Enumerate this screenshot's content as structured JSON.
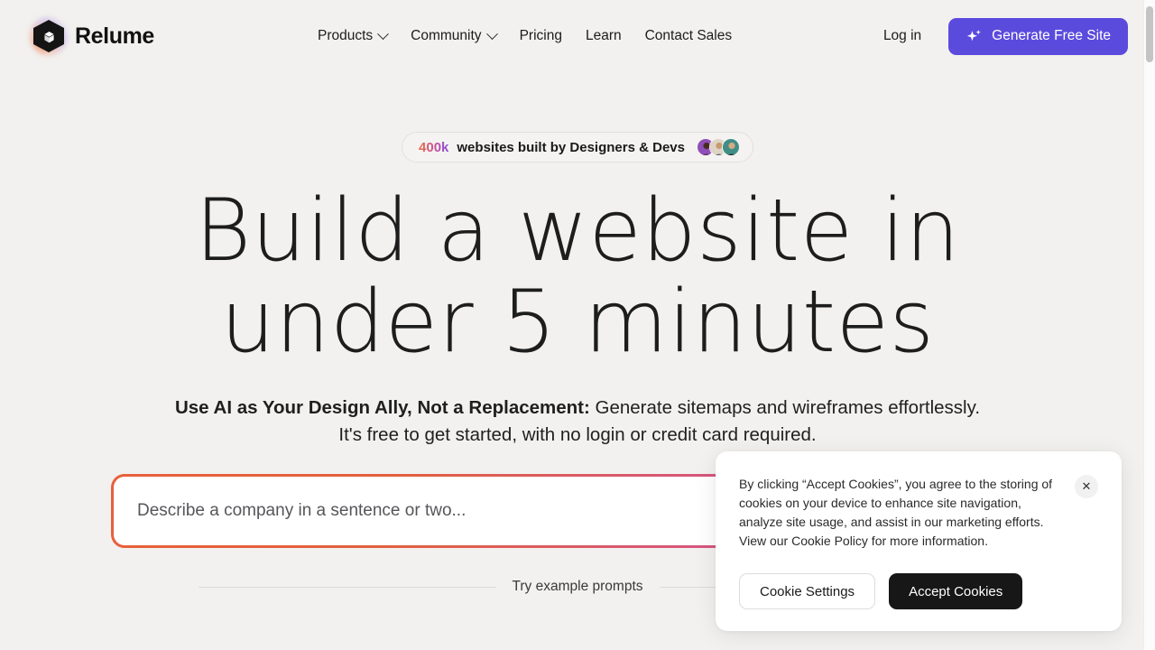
{
  "brand": {
    "name": "Relume",
    "logo_icon": "cube-hexagon-logo"
  },
  "nav": {
    "items": [
      {
        "label": "Products",
        "has_dropdown": true,
        "icon": "chevron-down-icon"
      },
      {
        "label": "Community",
        "has_dropdown": true,
        "icon": "chevron-down-icon"
      },
      {
        "label": "Pricing",
        "has_dropdown": false
      },
      {
        "label": "Learn",
        "has_dropdown": false
      },
      {
        "label": "Contact Sales",
        "has_dropdown": false
      }
    ],
    "login_label": "Log in",
    "cta_label": "Generate Free Site",
    "cta_icon": "sparkle-icon",
    "cta_color": "#5b4bdd"
  },
  "hero": {
    "badge": {
      "count": "400k",
      "text": "websites built by Designers & Devs",
      "count_gradient_from": "#ef6b43",
      "count_gradient_to": "#8d4ce0",
      "avatars": [
        "avatar-designer-1",
        "avatar-designer-2",
        "avatar-designer-3"
      ]
    },
    "headline_line1": "Build a website in",
    "headline_line2": "under 5 minutes",
    "subhead_bold": "Use AI as Your Design Ally, Not a Replacement:",
    "subhead_rest": " Generate sitemaps and wireframes effortlessly. It's free to get started, with no login or credit card required.",
    "prompt_placeholder": "Describe a company in a sentence or two...",
    "prompt_value": "",
    "prompt_border_from": "#e8603c",
    "prompt_border_to": "#a8479e",
    "examples_label": "Try example prompts"
  },
  "cookie_banner": {
    "body": "By clicking “Accept Cookies”, you agree to the storing of cookies on your device to enhance site navigation, analyze site usage, and assist in our marketing efforts. View our Cookie Policy for more information.",
    "close_icon": "close-icon",
    "close_glyph": "✕",
    "settings_label": "Cookie Settings",
    "accept_label": "Accept Cookies",
    "accept_color": "#171717"
  },
  "page": {
    "background": "#f2f1ef"
  }
}
